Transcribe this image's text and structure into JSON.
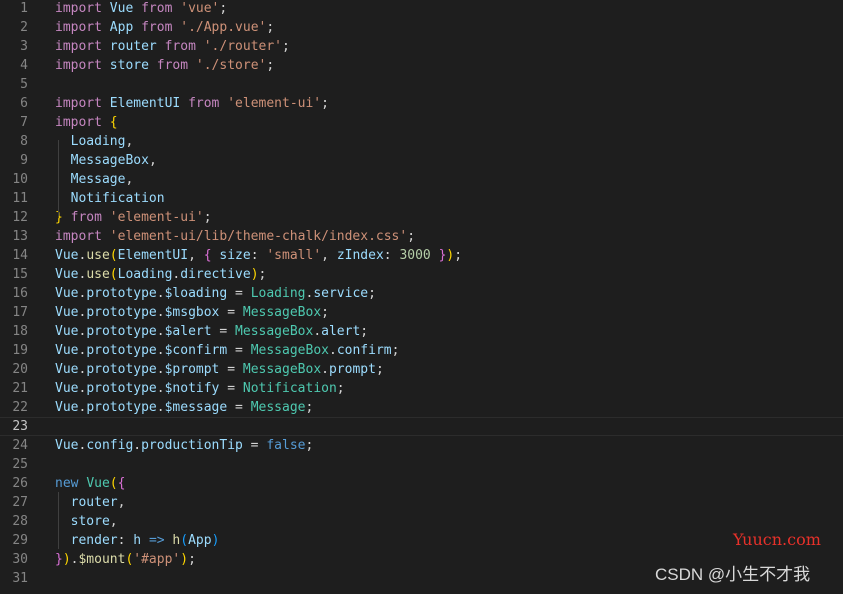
{
  "editor": {
    "language": "javascript",
    "current_line": 23,
    "lines": [
      {
        "n": "1",
        "tokens": [
          {
            "t": "import",
            "c": "kw"
          },
          {
            "t": " "
          },
          {
            "t": "Vue",
            "c": "vr"
          },
          {
            "t": " "
          },
          {
            "t": "from",
            "c": "kw"
          },
          {
            "t": " "
          },
          {
            "t": "'vue'",
            "c": "st"
          },
          {
            "t": ";"
          }
        ]
      },
      {
        "n": "2",
        "tokens": [
          {
            "t": "import",
            "c": "kw"
          },
          {
            "t": " "
          },
          {
            "t": "App",
            "c": "vr"
          },
          {
            "t": " "
          },
          {
            "t": "from",
            "c": "kw"
          },
          {
            "t": " "
          },
          {
            "t": "'./App.vue'",
            "c": "st"
          },
          {
            "t": ";"
          }
        ]
      },
      {
        "n": "3",
        "tokens": [
          {
            "t": "import",
            "c": "kw"
          },
          {
            "t": " "
          },
          {
            "t": "router",
            "c": "vr"
          },
          {
            "t": " "
          },
          {
            "t": "from",
            "c": "kw"
          },
          {
            "t": " "
          },
          {
            "t": "'./router'",
            "c": "st"
          },
          {
            "t": ";"
          }
        ]
      },
      {
        "n": "4",
        "tokens": [
          {
            "t": "import",
            "c": "kw"
          },
          {
            "t": " "
          },
          {
            "t": "store",
            "c": "vr"
          },
          {
            "t": " "
          },
          {
            "t": "from",
            "c": "kw"
          },
          {
            "t": " "
          },
          {
            "t": "'./store'",
            "c": "st"
          },
          {
            "t": ";"
          }
        ]
      },
      {
        "n": "5",
        "tokens": []
      },
      {
        "n": "6",
        "tokens": [
          {
            "t": "import",
            "c": "kw"
          },
          {
            "t": " "
          },
          {
            "t": "ElementUI",
            "c": "vr"
          },
          {
            "t": " "
          },
          {
            "t": "from",
            "c": "kw"
          },
          {
            "t": " "
          },
          {
            "t": "'element-ui'",
            "c": "st"
          },
          {
            "t": ";"
          }
        ]
      },
      {
        "n": "7",
        "tokens": [
          {
            "t": "import",
            "c": "kw"
          },
          {
            "t": " "
          },
          {
            "t": "{",
            "c": "p1"
          }
        ]
      },
      {
        "n": "8",
        "tokens": [
          {
            "t": "  "
          },
          {
            "t": "Loading",
            "c": "vr"
          },
          {
            "t": ","
          }
        ]
      },
      {
        "n": "9",
        "tokens": [
          {
            "t": "  "
          },
          {
            "t": "MessageBox",
            "c": "vr"
          },
          {
            "t": ","
          }
        ]
      },
      {
        "n": "10",
        "tokens": [
          {
            "t": "  "
          },
          {
            "t": "Message",
            "c": "vr"
          },
          {
            "t": ","
          }
        ]
      },
      {
        "n": "11",
        "tokens": [
          {
            "t": "  "
          },
          {
            "t": "Notification",
            "c": "vr"
          }
        ]
      },
      {
        "n": "12",
        "tokens": [
          {
            "t": "}",
            "c": "p1"
          },
          {
            "t": " "
          },
          {
            "t": "from",
            "c": "kw"
          },
          {
            "t": " "
          },
          {
            "t": "'element-ui'",
            "c": "st"
          },
          {
            "t": ";"
          }
        ]
      },
      {
        "n": "13",
        "tokens": [
          {
            "t": "import",
            "c": "kw"
          },
          {
            "t": " "
          },
          {
            "t": "'element-ui/lib/theme-chalk/index.css'",
            "c": "st"
          },
          {
            "t": ";"
          }
        ]
      },
      {
        "n": "14",
        "tokens": [
          {
            "t": "Vue",
            "c": "vr"
          },
          {
            "t": "."
          },
          {
            "t": "use",
            "c": "fn"
          },
          {
            "t": "(",
            "c": "p1"
          },
          {
            "t": "ElementUI",
            "c": "vr"
          },
          {
            "t": ", "
          },
          {
            "t": "{",
            "c": "p2"
          },
          {
            "t": " "
          },
          {
            "t": "size",
            "c": "vr"
          },
          {
            "t": ": "
          },
          {
            "t": "'small'",
            "c": "st"
          },
          {
            "t": ", "
          },
          {
            "t": "zIndex",
            "c": "vr"
          },
          {
            "t": ": "
          },
          {
            "t": "3000",
            "c": "nm"
          },
          {
            "t": " "
          },
          {
            "t": "}",
            "c": "p2"
          },
          {
            "t": ")",
            "c": "p1"
          },
          {
            "t": ";"
          }
        ]
      },
      {
        "n": "15",
        "tokens": [
          {
            "t": "Vue",
            "c": "vr"
          },
          {
            "t": "."
          },
          {
            "t": "use",
            "c": "fn"
          },
          {
            "t": "(",
            "c": "p1"
          },
          {
            "t": "Loading",
            "c": "vr"
          },
          {
            "t": "."
          },
          {
            "t": "directive",
            "c": "vr"
          },
          {
            "t": ")",
            "c": "p1"
          },
          {
            "t": ";"
          }
        ]
      },
      {
        "n": "16",
        "tokens": [
          {
            "t": "Vue",
            "c": "vr"
          },
          {
            "t": "."
          },
          {
            "t": "prototype",
            "c": "vr"
          },
          {
            "t": "."
          },
          {
            "t": "$loading",
            "c": "vr"
          },
          {
            "t": " = "
          },
          {
            "t": "Loading",
            "c": "ty"
          },
          {
            "t": "."
          },
          {
            "t": "service",
            "c": "vr"
          },
          {
            "t": ";"
          }
        ]
      },
      {
        "n": "17",
        "tokens": [
          {
            "t": "Vue",
            "c": "vr"
          },
          {
            "t": "."
          },
          {
            "t": "prototype",
            "c": "vr"
          },
          {
            "t": "."
          },
          {
            "t": "$msgbox",
            "c": "vr"
          },
          {
            "t": " = "
          },
          {
            "t": "MessageBox",
            "c": "ty"
          },
          {
            "t": ";"
          }
        ]
      },
      {
        "n": "18",
        "tokens": [
          {
            "t": "Vue",
            "c": "vr"
          },
          {
            "t": "."
          },
          {
            "t": "prototype",
            "c": "vr"
          },
          {
            "t": "."
          },
          {
            "t": "$alert",
            "c": "vr"
          },
          {
            "t": " = "
          },
          {
            "t": "MessageBox",
            "c": "ty"
          },
          {
            "t": "."
          },
          {
            "t": "alert",
            "c": "vr"
          },
          {
            "t": ";"
          }
        ]
      },
      {
        "n": "19",
        "tokens": [
          {
            "t": "Vue",
            "c": "vr"
          },
          {
            "t": "."
          },
          {
            "t": "prototype",
            "c": "vr"
          },
          {
            "t": "."
          },
          {
            "t": "$confirm",
            "c": "vr"
          },
          {
            "t": " = "
          },
          {
            "t": "MessageBox",
            "c": "ty"
          },
          {
            "t": "."
          },
          {
            "t": "confirm",
            "c": "vr"
          },
          {
            "t": ";"
          }
        ]
      },
      {
        "n": "20",
        "tokens": [
          {
            "t": "Vue",
            "c": "vr"
          },
          {
            "t": "."
          },
          {
            "t": "prototype",
            "c": "vr"
          },
          {
            "t": "."
          },
          {
            "t": "$prompt",
            "c": "vr"
          },
          {
            "t": " = "
          },
          {
            "t": "MessageBox",
            "c": "ty"
          },
          {
            "t": "."
          },
          {
            "t": "prompt",
            "c": "vr"
          },
          {
            "t": ";"
          }
        ]
      },
      {
        "n": "21",
        "tokens": [
          {
            "t": "Vue",
            "c": "vr"
          },
          {
            "t": "."
          },
          {
            "t": "prototype",
            "c": "vr"
          },
          {
            "t": "."
          },
          {
            "t": "$notify",
            "c": "vr"
          },
          {
            "t": " = "
          },
          {
            "t": "Notification",
            "c": "ty"
          },
          {
            "t": ";"
          }
        ]
      },
      {
        "n": "22",
        "tokens": [
          {
            "t": "Vue",
            "c": "vr"
          },
          {
            "t": "."
          },
          {
            "t": "prototype",
            "c": "vr"
          },
          {
            "t": "."
          },
          {
            "t": "$message",
            "c": "vr"
          },
          {
            "t": " = "
          },
          {
            "t": "Message",
            "c": "ty"
          },
          {
            "t": ";"
          }
        ]
      },
      {
        "n": "23",
        "tokens": []
      },
      {
        "n": "24",
        "tokens": [
          {
            "t": "Vue",
            "c": "vr"
          },
          {
            "t": "."
          },
          {
            "t": "config",
            "c": "vr"
          },
          {
            "t": "."
          },
          {
            "t": "productionTip",
            "c": "vr"
          },
          {
            "t": " = "
          },
          {
            "t": "false",
            "c": "bl"
          },
          {
            "t": ";"
          }
        ]
      },
      {
        "n": "25",
        "tokens": []
      },
      {
        "n": "26",
        "tokens": [
          {
            "t": "new",
            "c": "bl"
          },
          {
            "t": " "
          },
          {
            "t": "Vue",
            "c": "ty"
          },
          {
            "t": "(",
            "c": "p1"
          },
          {
            "t": "{",
            "c": "p2"
          }
        ]
      },
      {
        "n": "27",
        "tokens": [
          {
            "t": "  "
          },
          {
            "t": "router",
            "c": "vr"
          },
          {
            "t": ","
          }
        ]
      },
      {
        "n": "28",
        "tokens": [
          {
            "t": "  "
          },
          {
            "t": "store",
            "c": "vr"
          },
          {
            "t": ","
          }
        ]
      },
      {
        "n": "29",
        "tokens": [
          {
            "t": "  "
          },
          {
            "t": "render",
            "c": "vr"
          },
          {
            "t": ": "
          },
          {
            "t": "h",
            "c": "vr"
          },
          {
            "t": " "
          },
          {
            "t": "=>",
            "c": "bl"
          },
          {
            "t": " "
          },
          {
            "t": "h",
            "c": "fn"
          },
          {
            "t": "(",
            "c": "p3"
          },
          {
            "t": "App",
            "c": "vr"
          },
          {
            "t": ")",
            "c": "p3"
          }
        ]
      },
      {
        "n": "30",
        "tokens": [
          {
            "t": "}",
            "c": "p2"
          },
          {
            "t": ")",
            "c": "p1"
          },
          {
            "t": "."
          },
          {
            "t": "$mount",
            "c": "fn"
          },
          {
            "t": "(",
            "c": "p1"
          },
          {
            "t": "'#app'",
            "c": "st"
          },
          {
            "t": ")",
            "c": "p1"
          },
          {
            "t": ";"
          }
        ]
      },
      {
        "n": "31",
        "tokens": []
      }
    ]
  },
  "watermarks": {
    "site": "Yuucn.com",
    "author": "CSDN @小生不才我"
  }
}
